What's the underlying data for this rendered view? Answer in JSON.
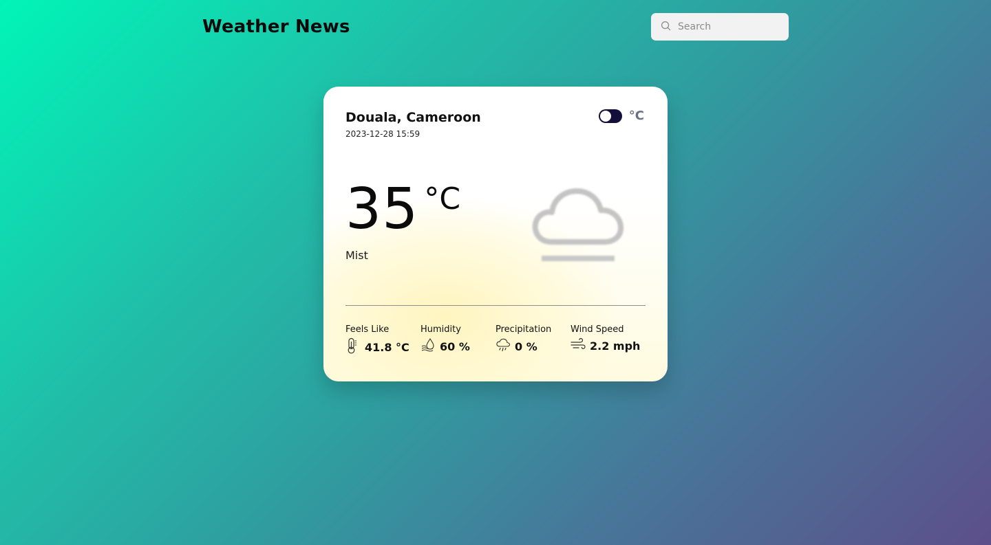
{
  "header": {
    "title": "Weather News",
    "search": {
      "placeholder": "Search",
      "value": "",
      "icon": "search-icon"
    }
  },
  "card": {
    "location": "Douala, Cameroon",
    "datetime": "2023-12-28 15:59",
    "unit_toggle": {
      "label": "°C",
      "state": "off"
    },
    "temperature": "35",
    "temperature_unit": "°C",
    "condition": "Mist",
    "condition_icon": "mist-cloud-icon",
    "stats": [
      {
        "label": "Feels Like",
        "value": "41.8 °C",
        "icon": "thermometer-icon"
      },
      {
        "label": "Humidity",
        "value": "60 %",
        "icon": "humidity-icon"
      },
      {
        "label": "Precipitation",
        "value": "0 %",
        "icon": "rain-cloud-icon"
      },
      {
        "label": "Wind Speed",
        "value": "2.2 mph",
        "icon": "wind-icon"
      }
    ]
  },
  "colors": {
    "background_start": "#00f5b8",
    "background_end": "#5d4f8a",
    "toggle_track": "#12103a",
    "unit_label": "#6b6f80"
  }
}
